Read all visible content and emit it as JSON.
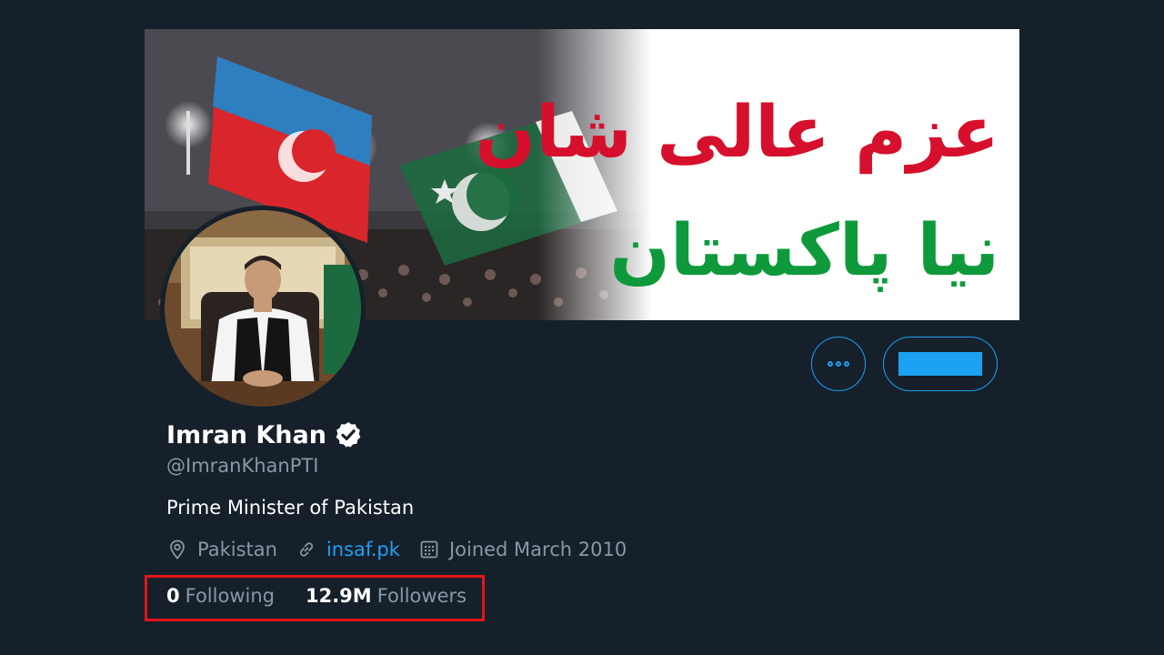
{
  "banner": {
    "urdu_line_1": "عزم عالی شان",
    "urdu_line_2": "نیا پاکستان",
    "line1_color": "#d6102c",
    "line2_color": "#0e9a3b"
  },
  "profile": {
    "name": "Imran Khan",
    "handle": "@ImranKhanPTI",
    "bio": "Prime Minister of Pakistan",
    "location": "Pakistan",
    "website": "insaf.pk",
    "joined": "Joined March 2010"
  },
  "stats": {
    "following_count": "0",
    "following_label": "Following",
    "followers_count": "12.9M",
    "followers_label": "Followers"
  },
  "colors": {
    "background": "#15202b",
    "accent": "#1da1f2",
    "muted": "#8899a6",
    "highlight_box": "#e3141a"
  },
  "icons": {
    "more": "more-horizontal-icon",
    "verified": "verified-badge-icon",
    "location": "location-pin-icon",
    "link": "link-icon",
    "calendar": "calendar-icon"
  }
}
